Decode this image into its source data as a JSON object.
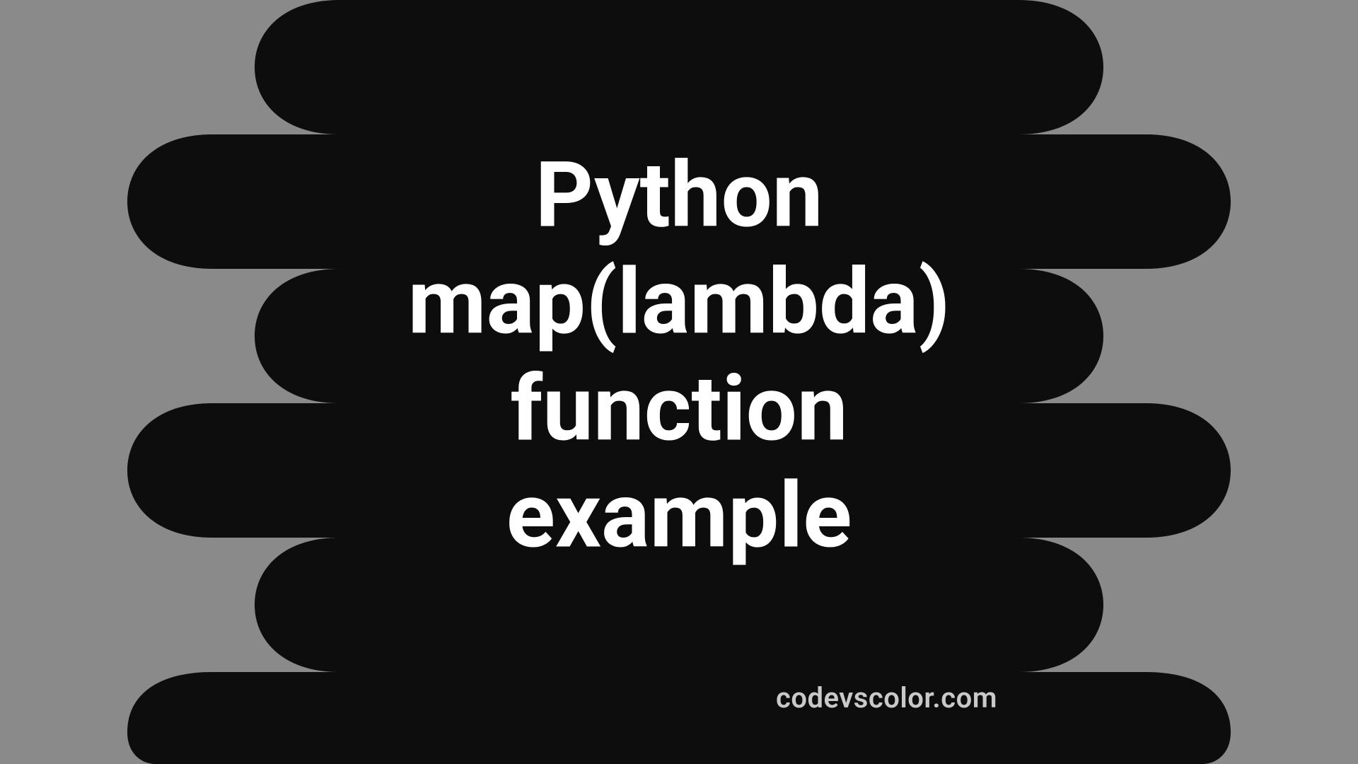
{
  "title": "Python\nmap(lambda)\nfunction\nexample",
  "site": "codevscolor.com",
  "colors": {
    "background": "#8a8a8a",
    "blob": "#0d0d0d",
    "title": "#ffffff",
    "site": "#c9c9c9"
  }
}
